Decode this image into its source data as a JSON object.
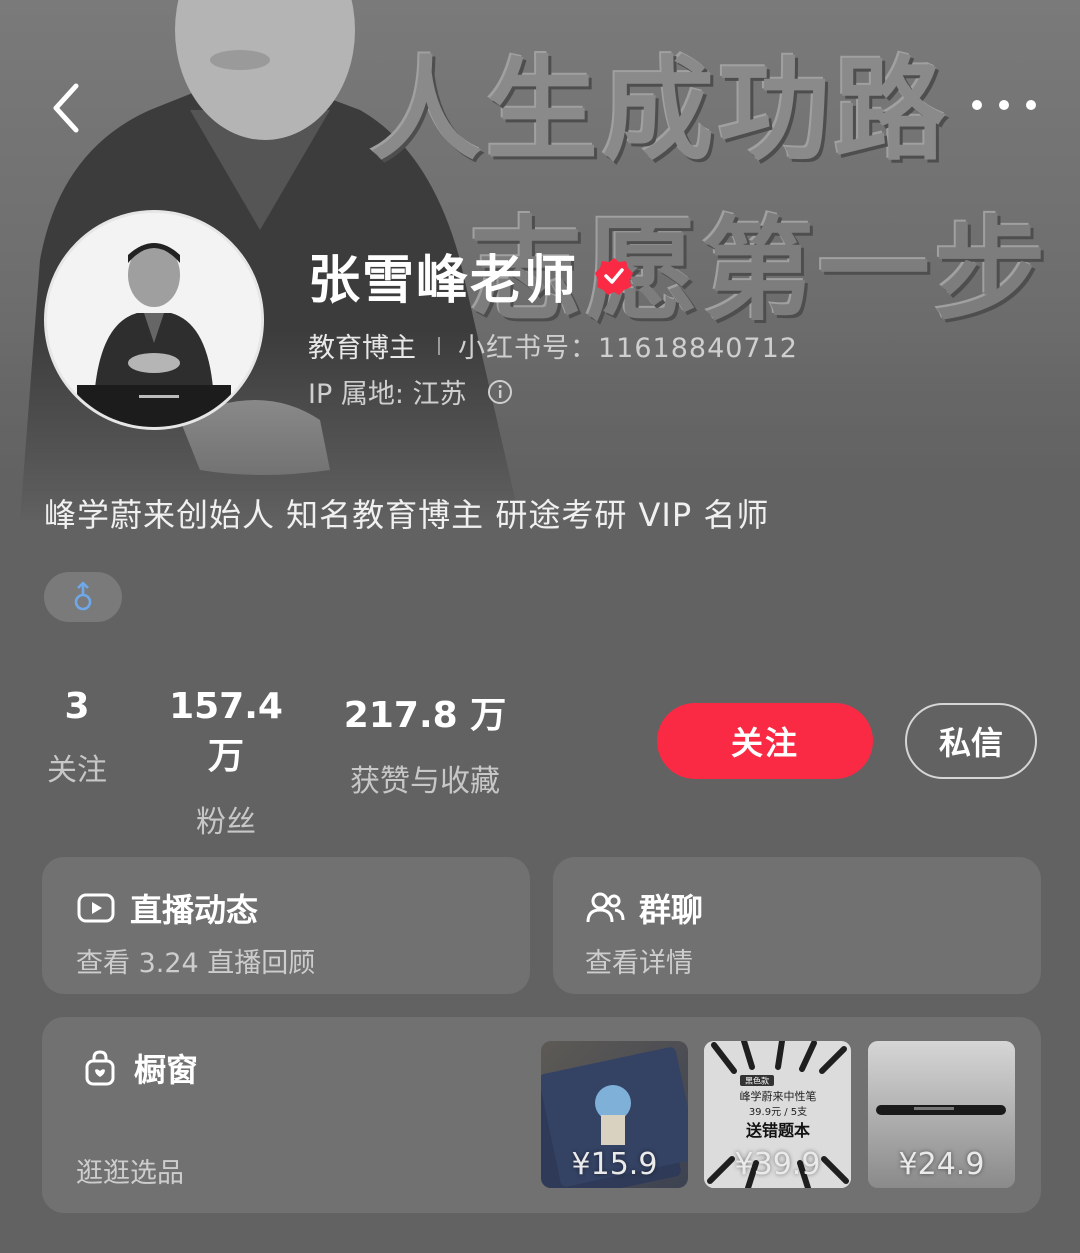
{
  "banner": {
    "line1": "人生成功路",
    "line2": "志愿第一步"
  },
  "profile": {
    "name": "张雪峰老师",
    "tag": "教育博主",
    "id_label": "小红书号：11618840712",
    "ip_label": "IP 属地: 江苏",
    "bio": "峰学蔚来创始人 知名教育博主 研途考研 VIP 名师",
    "gender_icon": "male-icon"
  },
  "stats": [
    {
      "value": "3",
      "label": "关注"
    },
    {
      "value": "157.4 万",
      "label": "粉丝"
    },
    {
      "value": "217.8 万",
      "label": "获赞与收藏"
    }
  ],
  "actions": {
    "follow_label": "关注",
    "message_label": "私信"
  },
  "cards": {
    "live": {
      "title": "直播动态",
      "subtitle": "查看 3.24 直播回顾",
      "icon": "live-video-icon"
    },
    "group": {
      "title": "群聊",
      "subtitle": "查看详情",
      "icon": "group-icon"
    },
    "shop": {
      "title": "橱窗",
      "subtitle": "逛逛选品",
      "icon": "shop-bag-icon",
      "products": [
        {
          "price": "¥15.9",
          "image_text": []
        },
        {
          "price": "¥39.9",
          "image_text": [
            "黑色款",
            "峰学蔚来中性笔",
            "39.9元 / 5支",
            "送错题本"
          ]
        },
        {
          "price": "¥24.9",
          "image_text": []
        }
      ]
    }
  },
  "colors": {
    "accent_red": "#fa2a45",
    "background": "#626262",
    "card": "#717171"
  }
}
